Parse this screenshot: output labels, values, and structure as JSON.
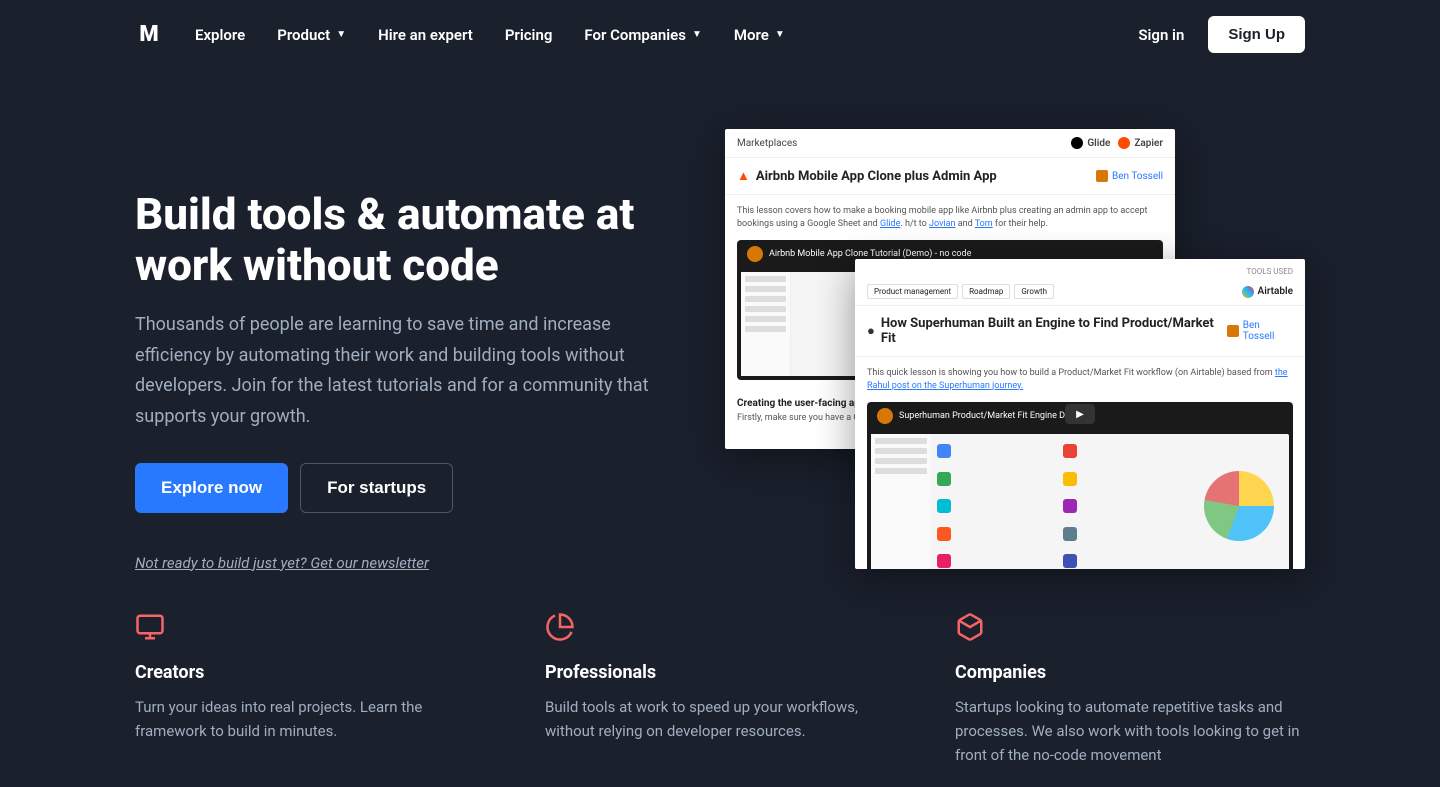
{
  "nav": {
    "explore": "Explore",
    "product": "Product",
    "hire": "Hire an expert",
    "pricing": "Pricing",
    "companies": "For Companies",
    "more": "More",
    "signin": "Sign in",
    "signup": "Sign Up"
  },
  "hero": {
    "title": "Build tools & automate at work without code",
    "desc": "Thousands of people are learning to save time and increase efficiency by automating their work and building tools without developers. Join for the latest tutorials and for a community that supports your growth.",
    "cta1": "Explore now",
    "cta2": "For startups",
    "newsletter": "Not ready to build just yet? Get our newsletter"
  },
  "card1": {
    "breadcrumb": "Marketplaces",
    "tool1": "Glide",
    "tool2": "Zapier",
    "title": "Airbnb Mobile App Clone plus Admin App",
    "author": "Ben Tossell",
    "desc_prefix": "This lesson covers how to make a booking mobile app like Airbnb plus creating an admin app to accept bookings using a Google Sheet and ",
    "desc_link1": "Glide",
    "desc_mid": ". h/t to ",
    "desc_link2": "Jovian",
    "desc_and": " and ",
    "desc_link3": "Tom",
    "desc_suffix": " for their help.",
    "video_title": "Airbnb Mobile App Clone Tutorial (Demo) - no code",
    "footer_title": "Creating the user-facing app",
    "footer_desc": "Firstly, make sure you have a Glide ac... with these headers:"
  },
  "card2": {
    "tools_label": "TOOLS USED",
    "tool1": "Airtable",
    "tab1": "Product management",
    "tab2": "Roadmap",
    "tab3": "Growth",
    "title": "How Superhuman Built an Engine to Find Product/Market Fit",
    "author": "Ben Tossell",
    "desc_prefix": "This quick lesson is showing you how to build a Product/Market Fit workflow (on Airtable) based from ",
    "desc_link": "the Rahul post on the Superhuman journey.",
    "video_title": "Superhuman Product/Market Fit Engine Demo"
  },
  "features": [
    {
      "title": "Creators",
      "desc": "Turn your ideas into real projects. Learn the framework to build in minutes."
    },
    {
      "title": "Professionals",
      "desc": "Build tools at work to speed up your workflows, without relying on developer resources."
    },
    {
      "title": "Companies",
      "desc": "Startups looking to automate repetitive tasks and processes. We also work with tools looking to get in front of the no-code movement"
    }
  ]
}
